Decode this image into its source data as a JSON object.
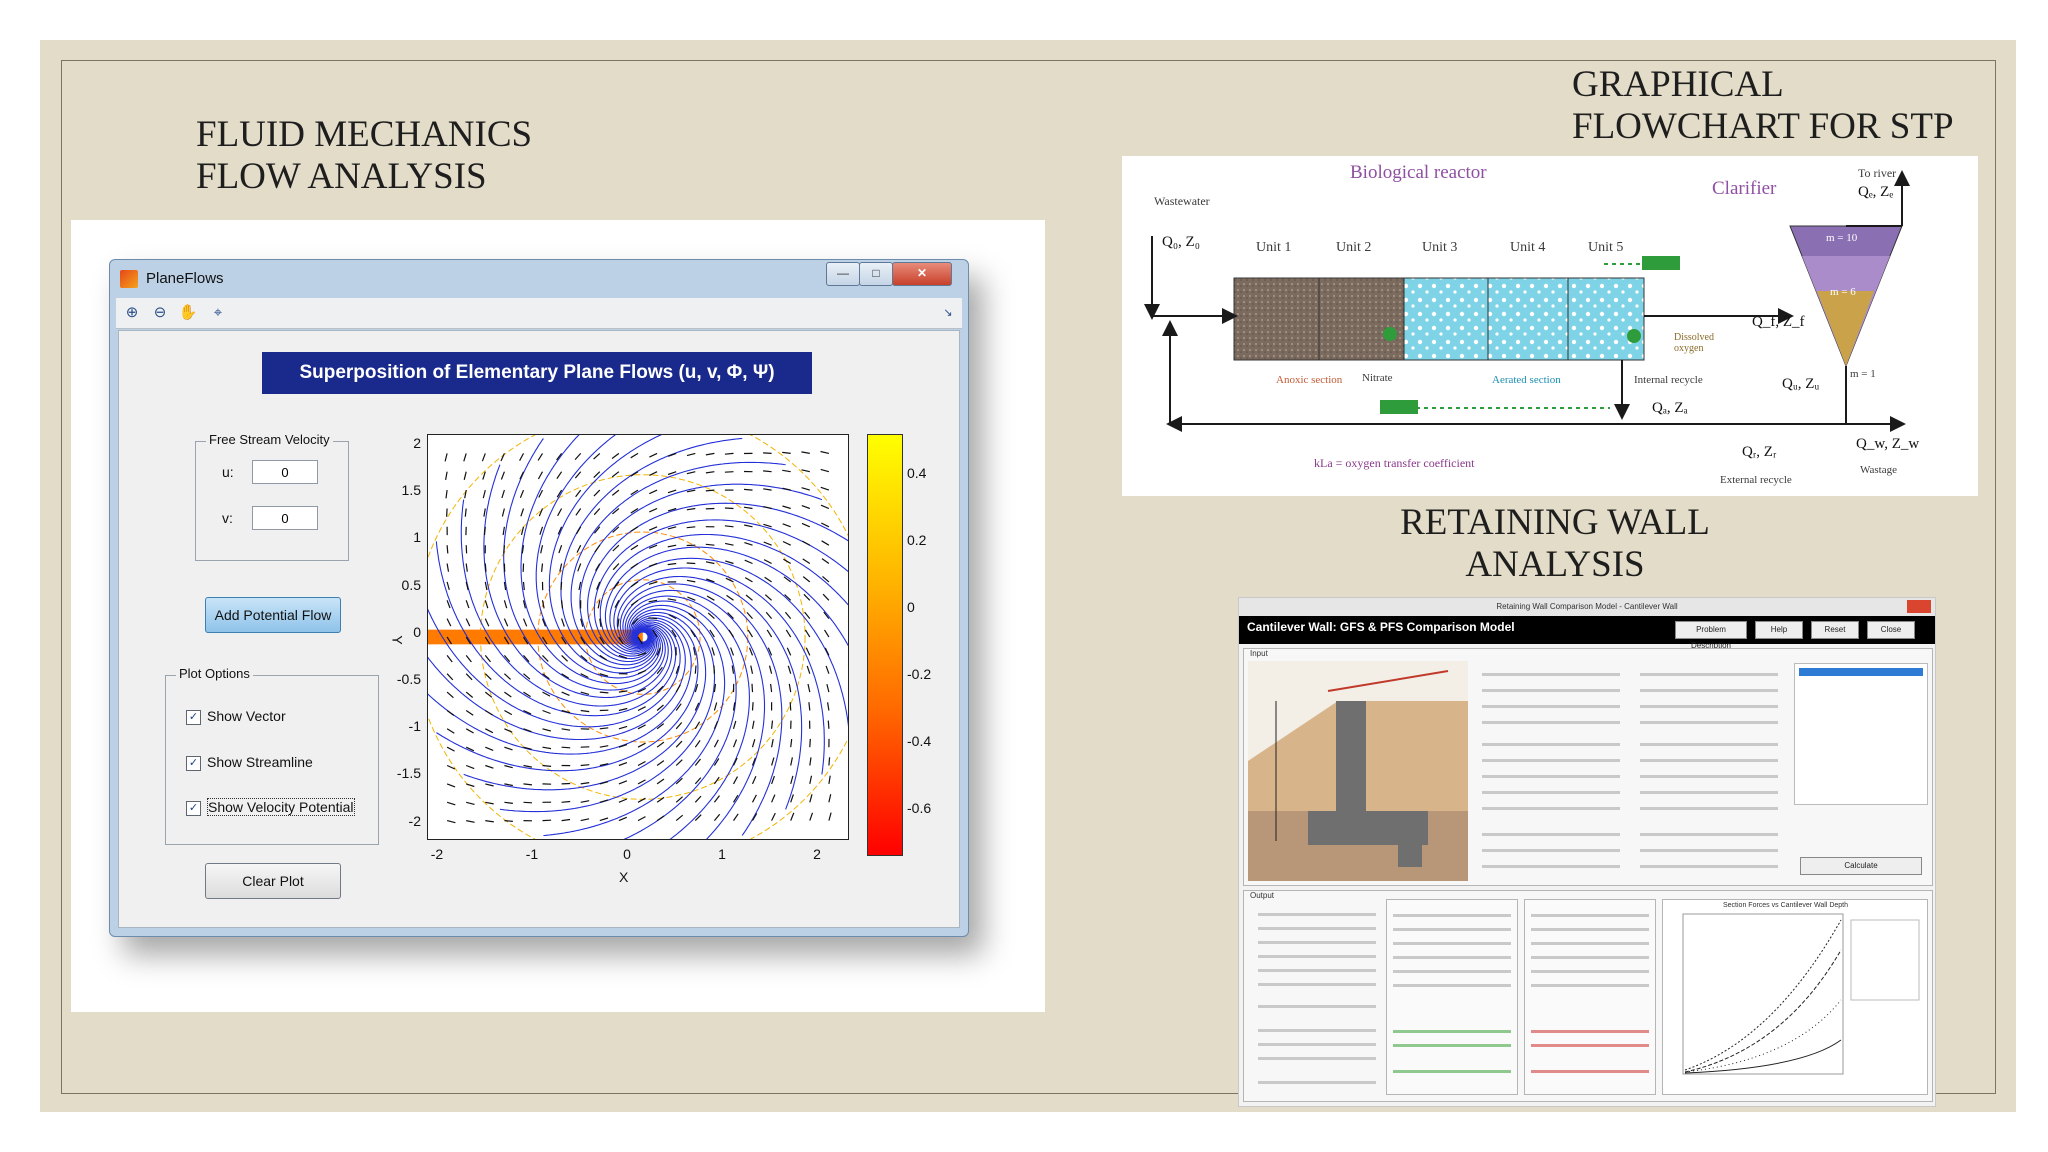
{
  "headings": {
    "fluid": "FLUID MECHANICS\nFLOW ANALYSIS",
    "stp": "GRAPHICAL\nFLOWCHART FOR STP",
    "wall": "RETAINING WALL\nANALYSIS"
  },
  "planeflows": {
    "window_title": "PlaneFlows",
    "window_buttons": [
      "—",
      "□",
      "✕"
    ],
    "toolbar_icons": [
      "zoom-in-icon",
      "zoom-out-icon",
      "pan-hand-icon",
      "data-cursor-icon"
    ],
    "banner": "Superposition of Elementary Plane Flows (u, v, Φ, Ψ)",
    "free_stream": {
      "title": "Free Stream Velocity",
      "u_label": "u:",
      "u_value": "0",
      "v_label": "v:",
      "v_value": "0"
    },
    "add_button": "Add Potential Flow",
    "plot_options": {
      "title": "Plot Options",
      "options": [
        {
          "label": "Show Vector",
          "checked": true
        },
        {
          "label": "Show Streamline",
          "checked": true
        },
        {
          "label": "Show Velocity Potential",
          "checked": true
        }
      ]
    },
    "clear_button": "Clear Plot",
    "x_ticks": [
      "-2",
      "-1",
      "0",
      "1",
      "2"
    ],
    "y_ticks": [
      "2",
      "1.5",
      "1",
      "0.5",
      "0",
      "-0.5",
      "-1",
      "-1.5",
      "-2"
    ],
    "x_label": "X",
    "y_label": "Y",
    "colorbar_ticks": [
      "0.4",
      "0.2",
      "0",
      "-0.2",
      "-0.4",
      "-0.6"
    ],
    "colors": {
      "streamline": "#2430d8",
      "vector": "#111111",
      "potential": "#f2b400",
      "banner": "#1a2a8c"
    }
  },
  "stp": {
    "title_reactor": "Biological reactor",
    "title_clarifier": "Clarifier",
    "wastewater": "Wastewater",
    "inlet": "Q₀, Z₀",
    "units": [
      "Unit 1",
      "Unit 2",
      "Unit 3",
      "Unit 4",
      "Unit 5"
    ],
    "to_river": "To river",
    "qe": "Qₑ, Zₑ",
    "qf": "Q_f, Z_f",
    "qu": "Qᵤ, Zᵤ",
    "qa": "Qₐ, Zₐ",
    "qr": "Qᵣ, Zᵣ",
    "qw": "Q_w, Z_w",
    "layers": [
      "m = 10",
      "m = 6",
      "m = 1"
    ],
    "labels": [
      "Anoxic section",
      "Nitrate",
      "Aerated section",
      "Internal recycle",
      "Dissolved oxygen",
      "External recycle",
      "Wastage"
    ],
    "kla_note": "kLa = oxygen transfer coefficient",
    "colors": {
      "anoxic": "#8a7a6a",
      "aerated": "#7fd3e6",
      "clarifier": "#8a6fb3",
      "arrow": "#1a1a1a",
      "tag": "#2e9c3a"
    }
  },
  "wall": {
    "window_title": "Retaining Wall Comparison Model - Cantilever Wall",
    "app_title": "Cantilever Wall: GFS & PFS Comparison Model",
    "header_buttons": [
      "Problem Description",
      "Help",
      "Reset",
      "Close"
    ],
    "section_input": "Input",
    "section_output": "Output",
    "calculate": "Calculate",
    "chart_title": "Section Forces vs Cantilever Wall Depth"
  }
}
